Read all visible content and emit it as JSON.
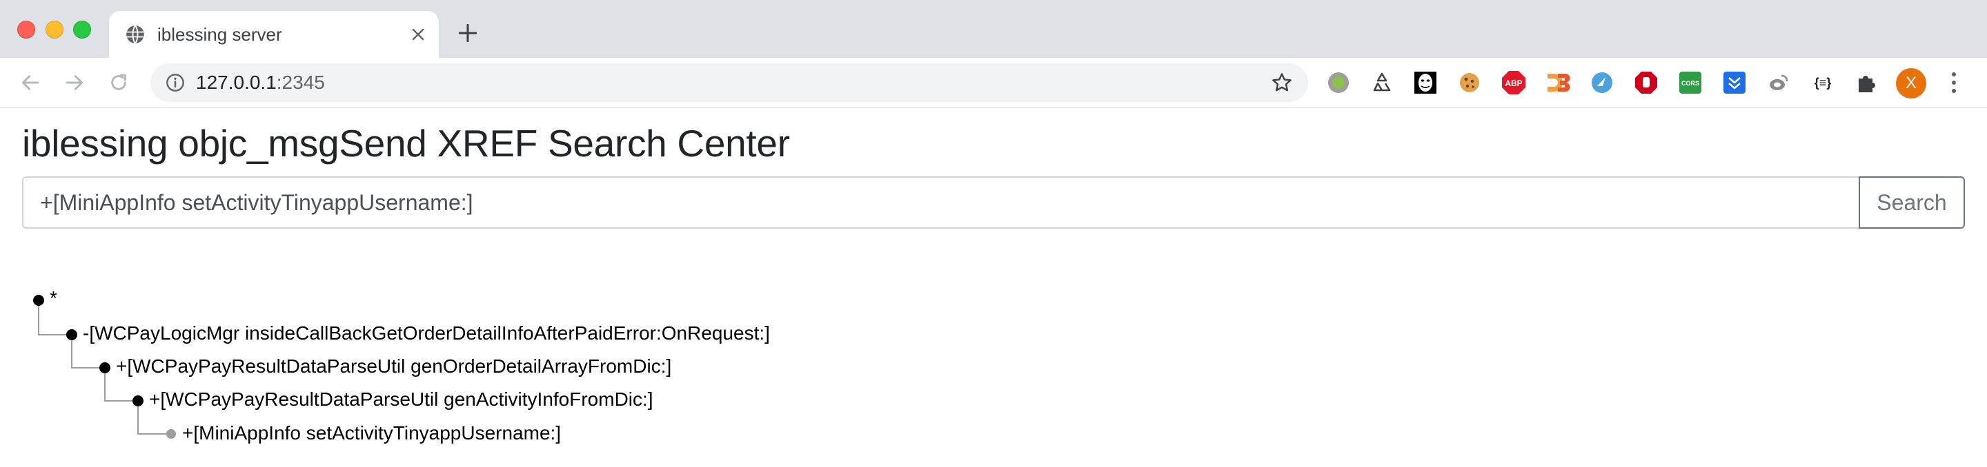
{
  "browser": {
    "tab": {
      "title": "iblessing server",
      "favicon": "globe-icon"
    },
    "new_tab_icon": "plus-icon",
    "nav": {
      "back_icon": "arrow-left-icon",
      "forward_icon": "arrow-right-icon",
      "reload_icon": "reload-icon"
    },
    "omnibox": {
      "info_icon": "info-icon",
      "host": "127.0.0.1",
      "port": ":2345",
      "star_icon": "star-icon"
    },
    "extensions": [
      {
        "name": "grey-circle-extension-icon"
      },
      {
        "name": "recycle-extension-icon"
      },
      {
        "name": "mask-extension-icon"
      },
      {
        "name": "cookie-extension-icon"
      },
      {
        "name": "adblock-plus-extension-icon",
        "label": "ABP"
      },
      {
        "name": "d3-extension-icon"
      },
      {
        "name": "bird-extension-icon"
      },
      {
        "name": "stop-hand-extension-icon"
      },
      {
        "name": "cors-extension-icon",
        "label": "CORS"
      },
      {
        "name": "download-extension-icon"
      },
      {
        "name": "weibo-extension-icon"
      },
      {
        "name": "json-extension-icon",
        "label": "{≡}"
      },
      {
        "name": "puzzle-extension-icon"
      }
    ],
    "profile": {
      "initial": "X",
      "color": "#e8710a"
    },
    "menu_icon": "more-vert-icon"
  },
  "page": {
    "title": "iblessing objc_msgSend XREF Search Center",
    "search": {
      "value": "+[MiniAppInfo setActivityTinyappUsername:]",
      "button_label": "Search"
    },
    "tree": {
      "root_label": "*",
      "nodes": [
        {
          "depth": 1,
          "label": "-[WCPayLogicMgr insideCallBackGetOrderDetailInfoAfterPaidError:OnRequest:]"
        },
        {
          "depth": 2,
          "label": "+[WCPayPayResultDataParseUtil genOrderDetailArrayFromDic:]"
        },
        {
          "depth": 3,
          "label": "+[WCPayPayResultDataParseUtil genActivityInfoFromDic:]"
        },
        {
          "depth": 4,
          "label": "+[MiniAppInfo setActivityTinyappUsername:]",
          "leaf": true
        }
      ]
    }
  },
  "colors": {
    "tabstrip": "#dee1e6",
    "link_line": "#9e9e9e",
    "node": "#000000",
    "leaf_node": "#9e9e9e"
  }
}
